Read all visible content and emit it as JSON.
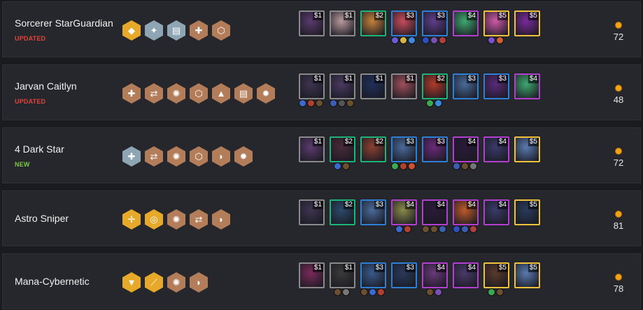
{
  "comps": [
    {
      "name": "Sorcerer StarGuardian",
      "tag": "UPDATED",
      "tag_color": "#e0443a",
      "traits": [
        {
          "icon": "sorcerer-trait-icon",
          "tier": "gold"
        },
        {
          "icon": "star-guardian-trait-icon",
          "tier": "silver"
        },
        {
          "icon": "book-trait-icon",
          "tier": "silver"
        },
        {
          "icon": "cross-trait-icon",
          "tier": "bronze"
        },
        {
          "icon": "shield-trait-icon",
          "tier": "bronze"
        }
      ],
      "units": [
        {
          "cost": "$1",
          "tier": 1,
          "color": "#5b3a6e",
          "items": []
        },
        {
          "cost": "$1",
          "tier": 1,
          "color": "#b99a9e",
          "items": []
        },
        {
          "cost": "$2",
          "tier": 2,
          "color": "#c4813a",
          "items": []
        },
        {
          "cost": "$3",
          "tier": 3,
          "color": "#c94b5a",
          "items": [
            "#6b5bd6",
            "#d9b640",
            "#3b8ae0"
          ]
        },
        {
          "cost": "$3",
          "tier": 3,
          "color": "#5f3d8a",
          "items": [
            "#2d4fc0",
            "#7a4fb0",
            "#b04040"
          ]
        },
        {
          "cost": "$4",
          "tier": 4,
          "color": "#3ea870",
          "items": []
        },
        {
          "cost": "$5",
          "tier": 5,
          "color": "#d05aa8",
          "items": [
            "#7a4fd0",
            "#d06030"
          ]
        },
        {
          "cost": "$5",
          "tier": 5,
          "color": "#7a2a9a",
          "items": []
        }
      ],
      "score": "72"
    },
    {
      "name": "Jarvan Caitlyn",
      "tag": "UPDATED",
      "tag_color": "#e0443a",
      "traits": [
        {
          "icon": "cross-trait-icon",
          "tier": "bronze"
        },
        {
          "icon": "infiltrator-trait-icon",
          "tier": "bronze"
        },
        {
          "icon": "cybernetic-trait-icon",
          "tier": "bronze"
        },
        {
          "icon": "shield-trait-icon",
          "tier": "bronze"
        },
        {
          "icon": "vanguard-trait-icon",
          "tier": "bronze"
        },
        {
          "icon": "book-trait-icon",
          "tier": "bronze"
        },
        {
          "icon": "gear-trait-icon",
          "tier": "bronze"
        }
      ],
      "units": [
        {
          "cost": "$1",
          "tier": 1,
          "color": "#3d3550",
          "items": [
            "#3b6ad0",
            "#b04030",
            "#6a5030"
          ]
        },
        {
          "cost": "$1",
          "tier": 1,
          "color": "#4a3a60",
          "items": [
            "#3a5fb0",
            "#555",
            "#6a5030"
          ]
        },
        {
          "cost": "$1",
          "tier": 1,
          "color": "#1f2f5a",
          "items": []
        },
        {
          "cost": "$1",
          "tier": 1,
          "color": "#a0505a",
          "items": []
        },
        {
          "cost": "$2",
          "tier": 2,
          "color": "#b03a2a",
          "items": [
            "#3aaa50",
            "#3a8ae0"
          ]
        },
        {
          "cost": "$3",
          "tier": 3,
          "color": "#4a6a9a",
          "items": []
        },
        {
          "cost": "$3",
          "tier": 3,
          "color": "#5a2a7a",
          "items": []
        },
        {
          "cost": "$4",
          "tier": 4,
          "color": "#3ea870",
          "items": []
        }
      ],
      "score": "48"
    },
    {
      "name": "4 Dark Star",
      "tag": "NEW",
      "tag_color": "#7ac943",
      "traits": [
        {
          "icon": "cross-trait-icon",
          "tier": "silver"
        },
        {
          "icon": "infiltrator-trait-icon",
          "tier": "bronze"
        },
        {
          "icon": "cybernetic-trait-icon",
          "tier": "bronze"
        },
        {
          "icon": "shield-trait-icon",
          "tier": "bronze"
        },
        {
          "icon": "helmet-trait-icon",
          "tier": "bronze"
        },
        {
          "icon": "gear-trait-icon",
          "tier": "bronze"
        }
      ],
      "units": [
        {
          "cost": "$1",
          "tier": 1,
          "color": "#5b3a6e",
          "items": []
        },
        {
          "cost": "$2",
          "tier": 2,
          "color": "#4a2a3a",
          "items": [
            "#3a6ad0",
            "#6a5030"
          ]
        },
        {
          "cost": "$2",
          "tier": 2,
          "color": "#8a4030",
          "items": []
        },
        {
          "cost": "$3",
          "tier": 3,
          "color": "#4a6a9a",
          "items": [
            "#3aaa50",
            "#b04030",
            "#d05030"
          ]
        },
        {
          "cost": "$3",
          "tier": 3,
          "color": "#6a2a7a",
          "items": []
        },
        {
          "cost": "$4",
          "tier": 4,
          "color": "#2a1a3a",
          "items": [
            "#3a5fb0",
            "#6a5030",
            "#777"
          ]
        },
        {
          "cost": "$4",
          "tier": 4,
          "color": "#3a3a6a",
          "items": []
        },
        {
          "cost": "$5",
          "tier": 5,
          "color": "#5a7ab0",
          "items": []
        }
      ],
      "score": "72"
    },
    {
      "name": "Astro Sniper",
      "tag": "",
      "tag_color": "#7ac943",
      "traits": [
        {
          "icon": "sniper-trait-icon",
          "tier": "gold"
        },
        {
          "icon": "astro-trait-icon",
          "tier": "gold"
        },
        {
          "icon": "cybernetic-trait-icon",
          "tier": "bronze"
        },
        {
          "icon": "infiltrator-trait-icon",
          "tier": "bronze"
        },
        {
          "icon": "helmet-trait-icon",
          "tier": "bronze"
        }
      ],
      "units": [
        {
          "cost": "$1",
          "tier": 1,
          "color": "#3d3550",
          "items": []
        },
        {
          "cost": "$2",
          "tier": 2,
          "color": "#2a4a6a",
          "items": []
        },
        {
          "cost": "$3",
          "tier": 3,
          "color": "#4a6a9a",
          "items": []
        },
        {
          "cost": "$4",
          "tier": 4,
          "color": "#8a8a4a",
          "items": [
            "#3a6ad0",
            "#b04030"
          ]
        },
        {
          "cost": "$4",
          "tier": 4,
          "color": "#2a1a3a",
          "items": [
            "#6a5030",
            "#6a5030",
            "#3a5fb0"
          ]
        },
        {
          "cost": "$4",
          "tier": 4,
          "color": "#c05a2a",
          "items": [
            "#2d4fc0",
            "#3a5fb0",
            "#b04040"
          ]
        },
        {
          "cost": "$4",
          "tier": 4,
          "color": "#3a3a6a",
          "items": []
        },
        {
          "cost": "$5",
          "tier": 5,
          "color": "#2a3a5a",
          "items": []
        }
      ],
      "score": "81"
    },
    {
      "name": "Mana-Cybernetic",
      "tag": "",
      "tag_color": "#7ac943",
      "traits": [
        {
          "icon": "mana-reaver-trait-icon",
          "tier": "gold"
        },
        {
          "icon": "blademaster-trait-icon",
          "tier": "gold"
        },
        {
          "icon": "cybernetic-trait-icon",
          "tier": "bronze"
        },
        {
          "icon": "helmet-trait-icon",
          "tier": "bronze"
        }
      ],
      "units": [
        {
          "cost": "$1",
          "tier": 1,
          "color": "#7a2a5a",
          "items": []
        },
        {
          "cost": "$1",
          "tier": 1,
          "color": "#3a3a3a",
          "items": [
            "#6a5030",
            "#777"
          ]
        },
        {
          "cost": "$3",
          "tier": 3,
          "color": "#3a5a8a",
          "items": [
            "#6a5030",
            "#3a6ad0",
            "#b04030"
          ]
        },
        {
          "cost": "$3",
          "tier": 3,
          "color": "#2a3a5a",
          "items": []
        },
        {
          "cost": "$4",
          "tier": 4,
          "color": "#6a3a7a",
          "items": [
            "#6a5030",
            "#7a4fb0"
          ]
        },
        {
          "cost": "$4",
          "tier": 4,
          "color": "#4a3a6a",
          "items": []
        },
        {
          "cost": "$5",
          "tier": 5,
          "color": "#5a3a2a",
          "items": [
            "#3aaa50",
            "#6a5030"
          ]
        },
        {
          "cost": "$5",
          "tier": 5,
          "color": "#5a7ab0",
          "items": []
        }
      ],
      "score": "78"
    }
  ]
}
